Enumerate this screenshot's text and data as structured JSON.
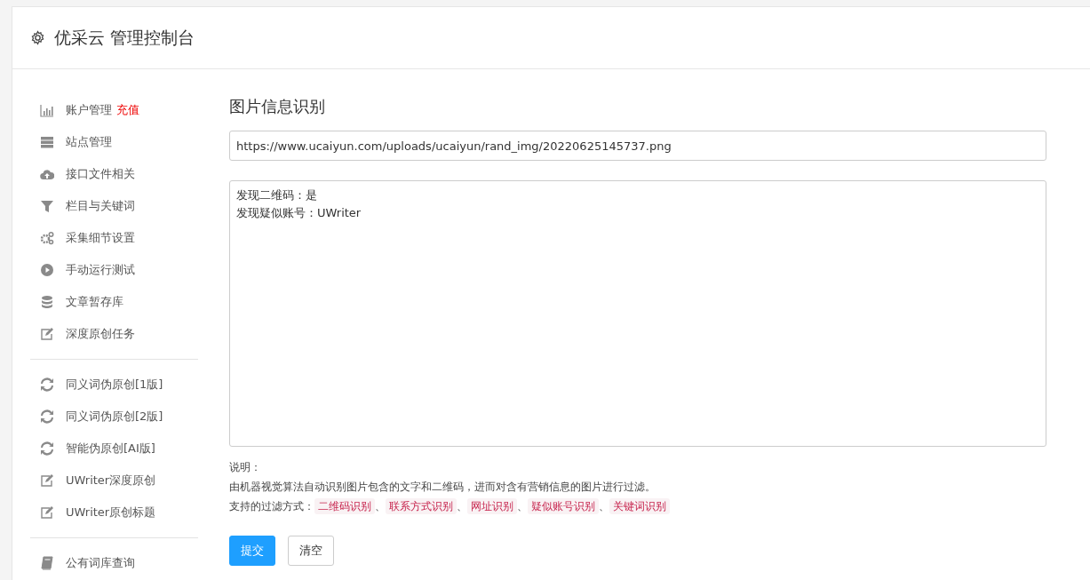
{
  "header": {
    "title": "优采云 管理控制台"
  },
  "sidebar": {
    "groups": [
      {
        "items": [
          {
            "label": "账户管理",
            "badge": "充值"
          },
          {
            "label": "站点管理"
          },
          {
            "label": "接口文件相关"
          },
          {
            "label": "栏目与关键词"
          },
          {
            "label": "采集细节设置"
          },
          {
            "label": "手动运行测试"
          },
          {
            "label": "文章暂存库"
          },
          {
            "label": "深度原创任务"
          }
        ]
      },
      {
        "items": [
          {
            "label": "同义词伪原创[1版]"
          },
          {
            "label": "同义词伪原创[2版]"
          },
          {
            "label": "智能伪原创[AI版]"
          },
          {
            "label": "UWriter深度原创"
          },
          {
            "label": "UWriter原创标题"
          }
        ]
      },
      {
        "items": [
          {
            "label": "公有词库查询"
          }
        ]
      }
    ]
  },
  "main": {
    "title": "图片信息识别",
    "url_field": {
      "value": "https://www.ucaiyun.com/uploads/ucaiyun/rand_img/20220625145737.png"
    },
    "result_field": {
      "lines": [
        "发现二维码：是",
        "发现疑似账号：UWriter"
      ]
    },
    "notes": {
      "heading": "说明：",
      "description": "由机器视觉算法自动识别图片包含的文字和二维码，进而对含有营销信息的图片进行过滤。",
      "filters_label": "支持的过滤方式：",
      "filters": [
        {
          "label": "二维码识别",
          "separator": "、"
        },
        {
          "label": "联系方式识别",
          "separator": "、"
        },
        {
          "label": "网址识别",
          "separator": "、"
        },
        {
          "label": "疑似账号识别",
          "separator": "、"
        },
        {
          "label": "关键词识别"
        }
      ]
    },
    "buttons": [
      {
        "label": "提交",
        "kind": "primary"
      },
      {
        "label": "清空",
        "kind": "default"
      }
    ]
  }
}
